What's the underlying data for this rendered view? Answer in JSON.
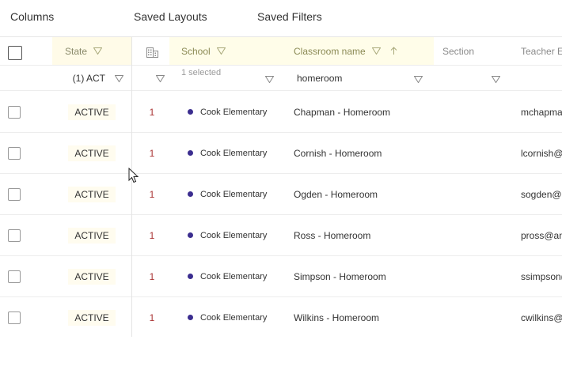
{
  "toolbar": {
    "columns_label": "Columns",
    "saved_layouts_label": "Saved Layouts",
    "saved_filters_label": "Saved Filters"
  },
  "grid": {
    "headers": {
      "state": "State",
      "school": "School",
      "classroom": "Classroom name",
      "section": "Section",
      "teacher": "Teacher Em"
    },
    "filters": {
      "state": "(1) ACT",
      "school_placeholder": "1 selected",
      "classroom_value": "homeroom"
    },
    "rows": [
      {
        "state": "ACTIVE",
        "num": "1",
        "school": "Cook Elementary",
        "classroom": "Chapman - Homeroom",
        "teacher": "mchapma"
      },
      {
        "state": "ACTIVE",
        "num": "1",
        "school": "Cook Elementary",
        "classroom": "Cornish - Homeroom",
        "teacher": "lcornish@"
      },
      {
        "state": "ACTIVE",
        "num": "1",
        "school": "Cook Elementary",
        "classroom": "Ogden - Homeroom",
        "teacher": "sogden@a"
      },
      {
        "state": "ACTIVE",
        "num": "1",
        "school": "Cook Elementary",
        "classroom": "Ross - Homeroom",
        "teacher": "pross@an"
      },
      {
        "state": "ACTIVE",
        "num": "1",
        "school": "Cook Elementary",
        "classroom": "Simpson - Homeroom",
        "teacher": "ssimpson("
      },
      {
        "state": "ACTIVE",
        "num": "1",
        "school": "Cook Elementary",
        "classroom": "Wilkins - Homeroom",
        "teacher": "cwilkins@"
      }
    ]
  },
  "colors": {
    "school_dot": "#3b2d8f",
    "count_text": "#aa3333",
    "highlight_column": "#fffde9"
  }
}
